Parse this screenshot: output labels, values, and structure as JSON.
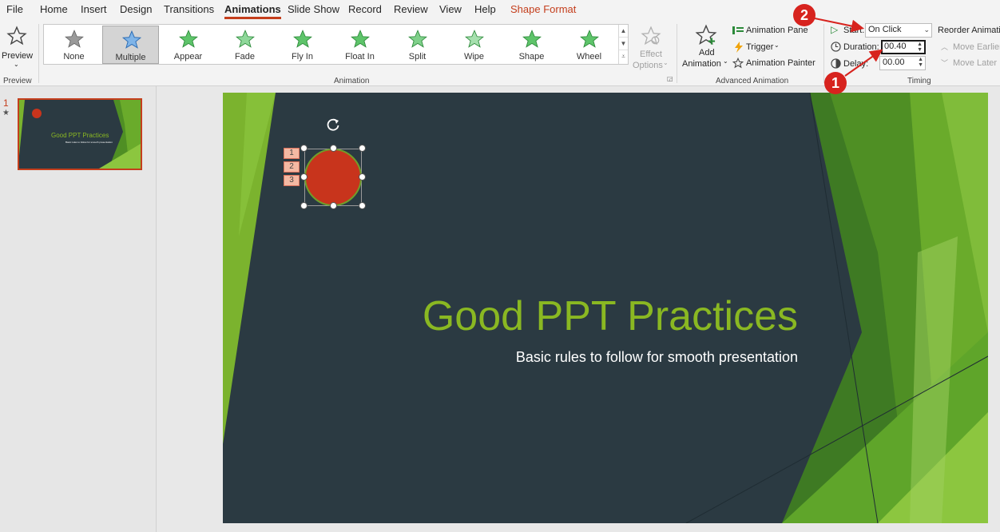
{
  "menu": {
    "tabs": [
      "File",
      "Home",
      "Insert",
      "Design",
      "Transitions",
      "Animations",
      "Slide Show",
      "Record",
      "Review",
      "View",
      "Help",
      "Shape Format"
    ],
    "active": "Animations"
  },
  "preview": {
    "label": "Preview",
    "group": "Preview"
  },
  "animation_group": {
    "label": "Animation",
    "items": [
      "None",
      "Multiple",
      "Appear",
      "Fade",
      "Fly In",
      "Float In",
      "Split",
      "Wipe",
      "Shape",
      "Wheel"
    ],
    "selected": "Multiple",
    "effect_options_line1": "Effect",
    "effect_options_line2": "Options"
  },
  "advanced": {
    "label": "Advanced Animation",
    "add_line1": "Add",
    "add_line2": "Animation",
    "pane": "Animation Pane",
    "trigger": "Trigger",
    "painter": "Animation Painter"
  },
  "timing": {
    "label": "Timing",
    "start_label": "Start:",
    "start_value": "On Click",
    "duration_label": "Duration:",
    "duration_value": "00.40",
    "delay_label": "Delay:",
    "delay_value": "00.00",
    "reorder": "Reorder Animation",
    "move_earlier": "Move Earlier",
    "move_later": "Move Later"
  },
  "slides": [
    {
      "number": "1",
      "title": "Good PPT Practices",
      "subtitle": "Basic rules to follow for smooth presentation"
    }
  ],
  "canvas": {
    "title": "Good PPT Practices",
    "subtitle": "Basic rules to follow for smooth presentation",
    "anim_tags": [
      "1",
      "2",
      "3"
    ]
  },
  "callouts": [
    "1",
    "2"
  ],
  "colors": {
    "accent": "#c43e1c",
    "title_green": "#8ab822",
    "slide_bg": "#2b3a42",
    "circle": "#c8341c",
    "badge": "#d7231e"
  }
}
